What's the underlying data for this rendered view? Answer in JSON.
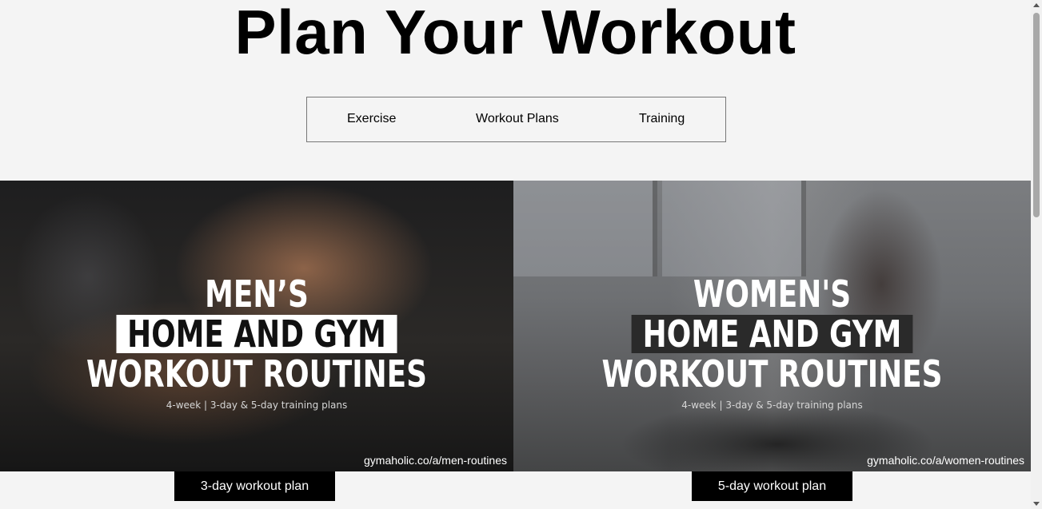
{
  "page": {
    "title": "Plan Your Workout"
  },
  "nav": {
    "items": [
      {
        "label": "Exercise"
      },
      {
        "label": "Workout Plans"
      },
      {
        "label": "Training"
      }
    ]
  },
  "cards": [
    {
      "line1": "MEN’S",
      "line2": "HOME AND GYM",
      "line3": "WORKOUT ROUTINES",
      "subtitle": "4-week | 3-day & 5-day training plans",
      "url": "gymaholic.co/a/men-routines",
      "button_label": "3-day workout plan"
    },
    {
      "line1": "WOMEN'S",
      "line2": "HOME AND GYM",
      "line3": "WORKOUT ROUTINES",
      "subtitle": "4-week | 3-day & 5-day training plans",
      "url": "gymaholic.co/a/women-routines",
      "button_label": "5-day workout plan"
    }
  ],
  "colors": {
    "background": "#f4f4f4",
    "button_bg": "#000000",
    "button_text": "#ffffff"
  }
}
